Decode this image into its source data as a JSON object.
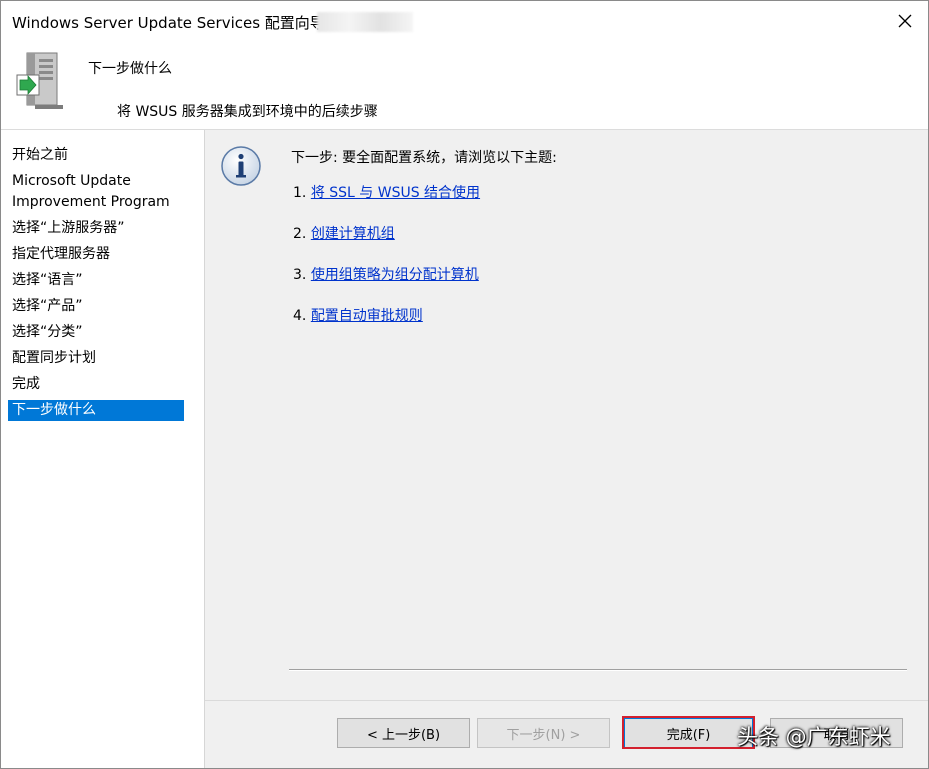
{
  "window": {
    "title": "Windows Server Update Services 配置向导",
    "close_icon": "close-icon"
  },
  "header": {
    "title": "下一步做什么",
    "subtitle": "将 WSUS 服务器集成到环境中的后续步骤",
    "icon": "server-update-icon"
  },
  "sidebar": {
    "items": [
      {
        "label": "开始之前"
      },
      {
        "label": "Microsoft Update Improvement Program"
      },
      {
        "label": "选择“上游服务器”"
      },
      {
        "label": "指定代理服务器"
      },
      {
        "label": "选择“语言”"
      },
      {
        "label": "选择“产品”"
      },
      {
        "label": "选择“分类”"
      },
      {
        "label": "配置同步计划"
      },
      {
        "label": "完成"
      },
      {
        "label": "下一步做什么"
      }
    ],
    "active_index": 9,
    "active_color": "#0078d7"
  },
  "main": {
    "info_icon": "info-icon",
    "intro": "下一步: 要全面配置系统，请浏览以下主题:",
    "steps": [
      {
        "num": "1.",
        "link": "将 SSL 与 WSUS 结合使用"
      },
      {
        "num": "2.",
        "link": "创建计算机组"
      },
      {
        "num": "3.",
        "link": "使用组策略为组分配计算机"
      },
      {
        "num": "4.",
        "link": "配置自动审批规则"
      }
    ],
    "link_color": "#0033cc"
  },
  "footer": {
    "back_label": "< 上一步(B)",
    "next_label": "下一步(N) >",
    "finish_label": "完成(F)",
    "cancel_label": "取消",
    "highlight_color": "#d3202e"
  },
  "watermark": {
    "text": "头条 @广东虾米"
  }
}
